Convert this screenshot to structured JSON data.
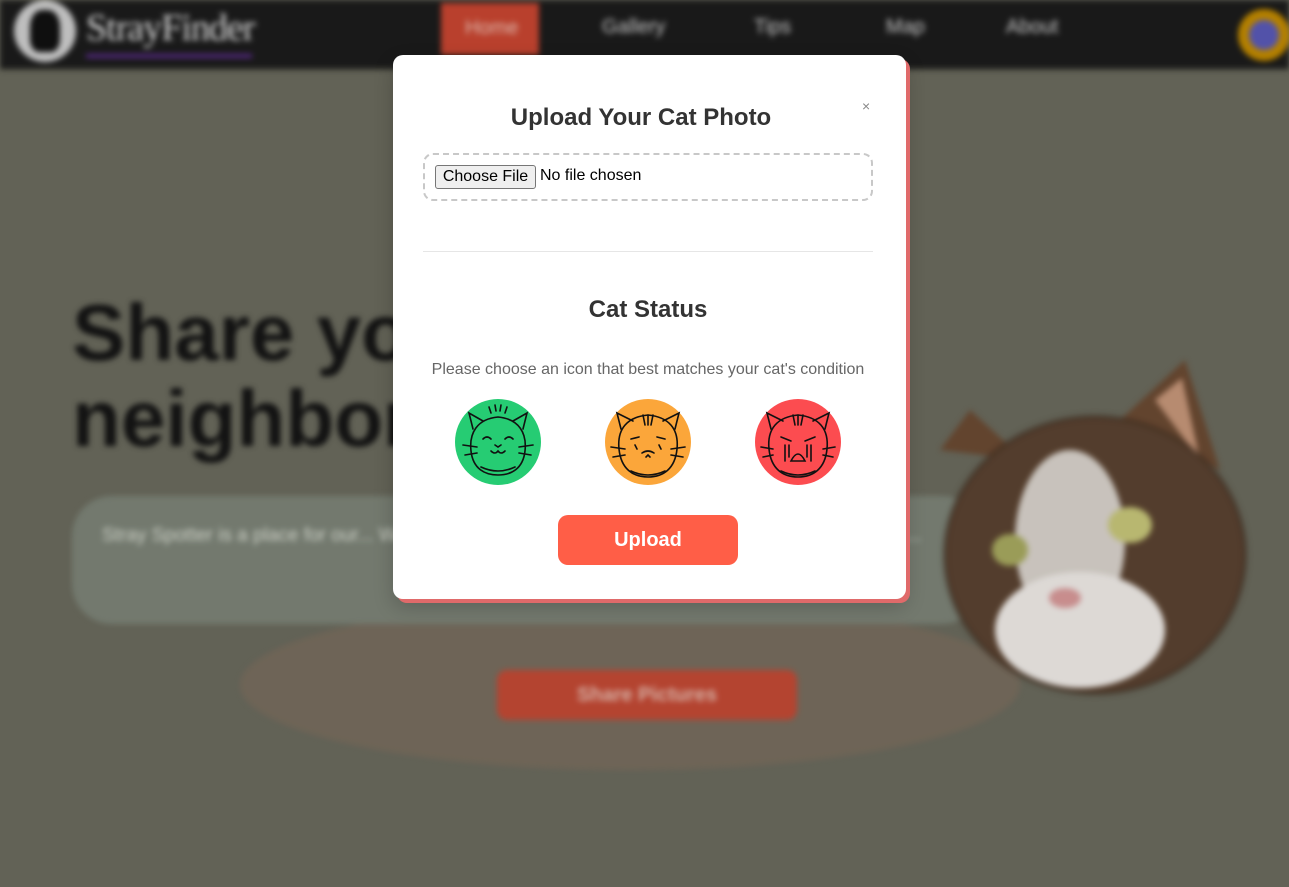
{
  "colors": {
    "accent": "#ff5e47",
    "happy": "#26cc73",
    "neutral": "#fba63a",
    "sad": "#fc4c50"
  },
  "background": {
    "logo_text": "StrayFinder",
    "nav": [
      "Home",
      "Gallery",
      "Tips",
      "Map",
      "About"
    ],
    "hero_title": "Share your neighbor",
    "hero_desc": "Stray Spotter is a place for our... We use the data to learn more... Keeping the community and s...",
    "share_button": "Share Pictures"
  },
  "modal": {
    "close_label": "×",
    "title": "Upload Your Cat Photo",
    "file_button": "Choose File",
    "file_status": "No file chosen",
    "status_title": "Cat Status",
    "status_hint": "Please choose an icon that best matches your cat's condition",
    "icons": [
      {
        "name": "happy-cat-icon",
        "mood": "happy"
      },
      {
        "name": "neutral-cat-icon",
        "mood": "worried"
      },
      {
        "name": "sad-cat-icon",
        "mood": "crying"
      }
    ],
    "upload_label": "Upload"
  }
}
